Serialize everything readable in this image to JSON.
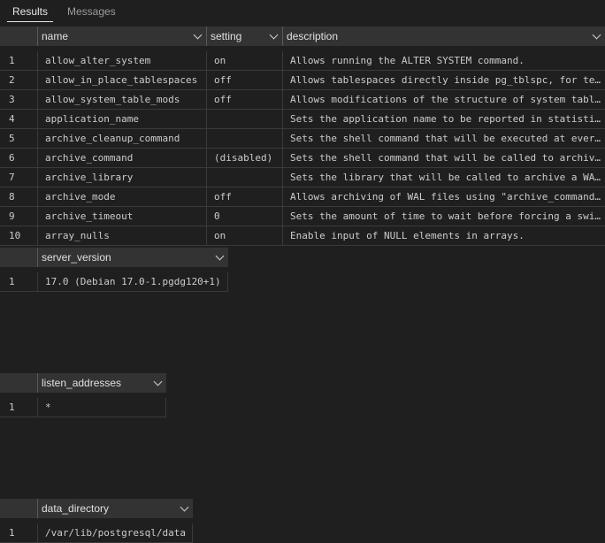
{
  "tabs": {
    "results": "Results",
    "messages": "Messages"
  },
  "settings_grid": {
    "columns": [
      "name",
      "setting",
      "description"
    ],
    "rows": [
      {
        "idx": "1",
        "name": "allow_alter_system",
        "setting": "on",
        "description": "Allows running the ALTER SYSTEM command."
      },
      {
        "idx": "2",
        "name": "allow_in_place_tablespaces",
        "setting": "off",
        "description": "Allows tablespaces directly inside pg_tblspc, for te…"
      },
      {
        "idx": "3",
        "name": "allow_system_table_mods",
        "setting": "off",
        "description": "Allows modifications of the structure of system tabl…"
      },
      {
        "idx": "4",
        "name": "application_name",
        "setting": "",
        "description": "Sets the application name to be reported in statisti…"
      },
      {
        "idx": "5",
        "name": "archive_cleanup_command",
        "setting": "",
        "description": "Sets the shell command that will be executed at ever…"
      },
      {
        "idx": "6",
        "name": "archive_command",
        "setting": "(disabled)",
        "description": "Sets the shell command that will be called to archiv…"
      },
      {
        "idx": "7",
        "name": "archive_library",
        "setting": "",
        "description": "Sets the library that will be called to archive a WA…"
      },
      {
        "idx": "8",
        "name": "archive_mode",
        "setting": "off",
        "description": "Allows archiving of WAL files using \"archive_command…"
      },
      {
        "idx": "9",
        "name": "archive_timeout",
        "setting": "0",
        "description": "Sets the amount of time to wait before forcing a swi…"
      },
      {
        "idx": "10",
        "name": "array_nulls",
        "setting": "on",
        "description": "Enable input of NULL elements in arrays."
      }
    ]
  },
  "version_grid": {
    "column": "server_version",
    "idx": "1",
    "value": "17.0 (Debian 17.0-1.pgdg120+1)"
  },
  "listen_grid": {
    "column": "listen_addresses",
    "idx": "1",
    "value": "*"
  },
  "datadir_grid": {
    "column": "data_directory",
    "idx": "1",
    "value": "/var/lib/postgresql/data"
  }
}
